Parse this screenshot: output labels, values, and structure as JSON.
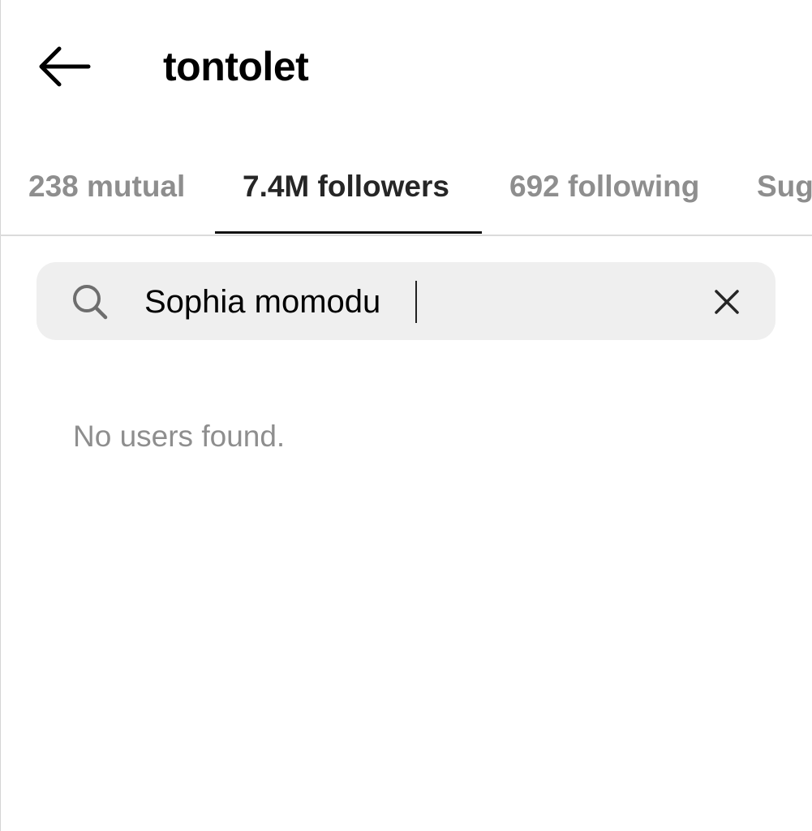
{
  "header": {
    "title": "tontolet",
    "back_icon": "arrow-left-icon"
  },
  "tabs": [
    {
      "label": "238 mutual",
      "active": false
    },
    {
      "label": "7.4M followers",
      "active": true
    },
    {
      "label": "692 following",
      "active": false
    },
    {
      "label": "Sug",
      "active": false
    }
  ],
  "search": {
    "icon": "search-icon",
    "value": "Sophia momodu",
    "clear_icon": "close-icon"
  },
  "results": {
    "empty_message": "No users found."
  },
  "colors": {
    "text_primary": "#000000",
    "text_secondary": "#8e8e8e",
    "search_background": "#efefef",
    "divider": "#dbdbdb"
  }
}
